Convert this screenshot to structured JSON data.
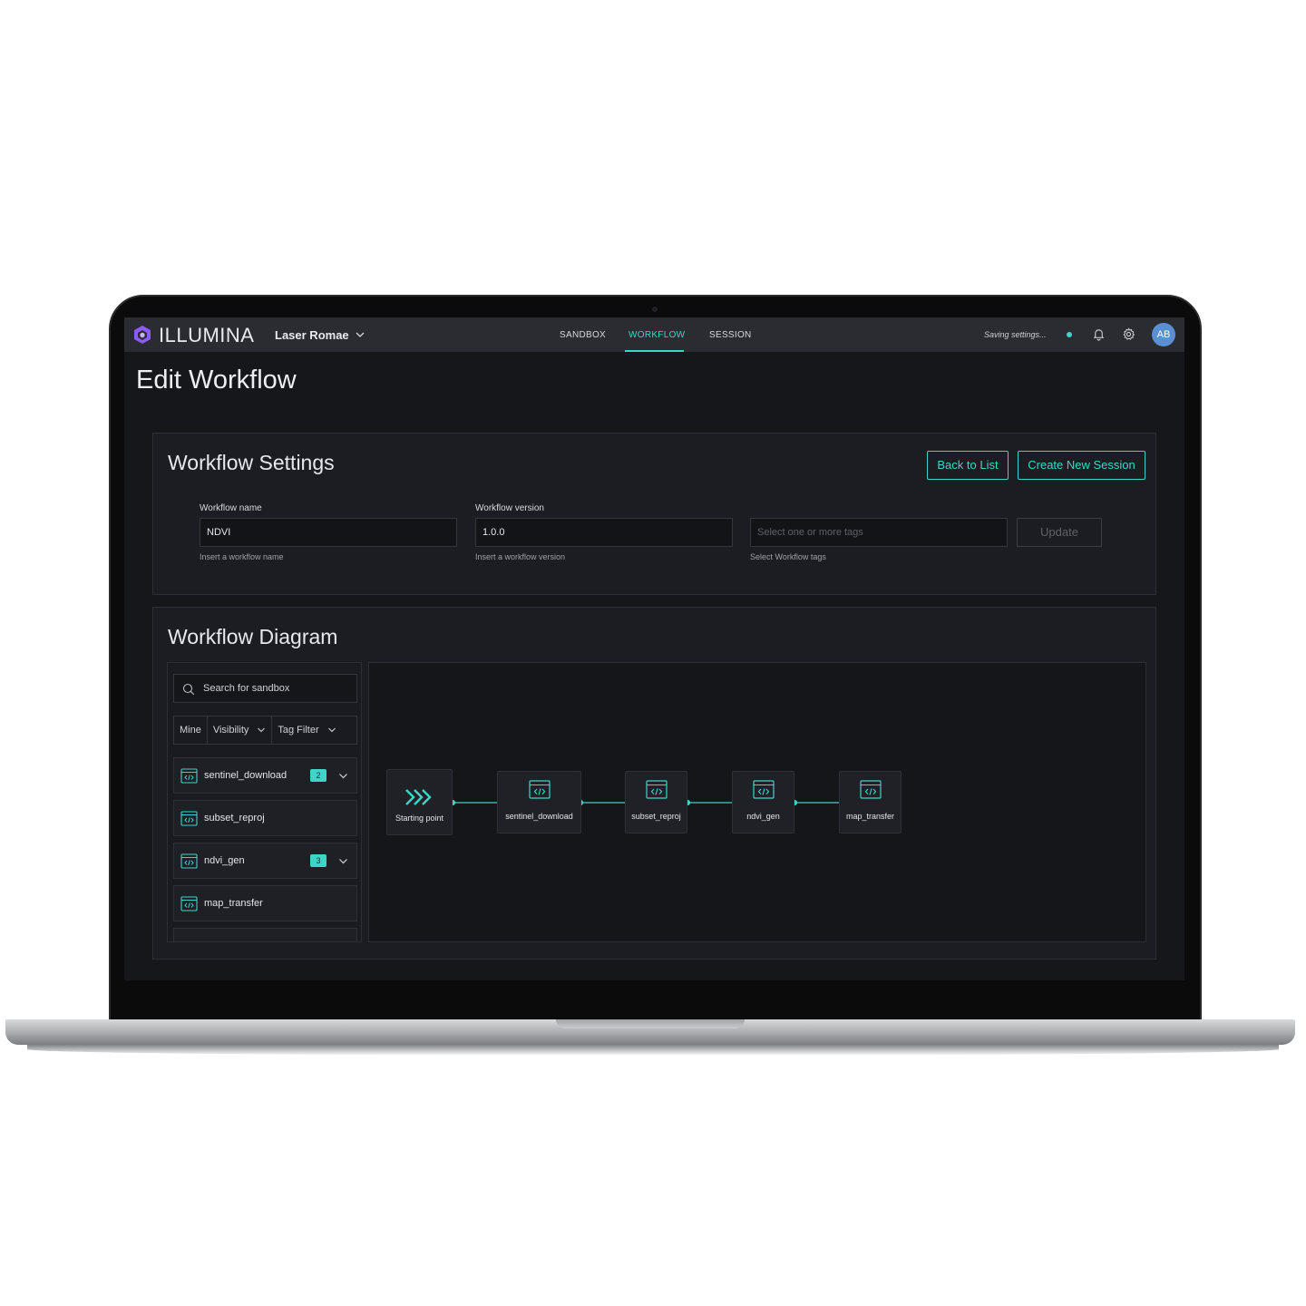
{
  "app": {
    "brand": "ILLUMINA",
    "project": "Laser Romae",
    "nav": [
      {
        "label": "SANDBOX",
        "active": false
      },
      {
        "label": "WORKFLOW",
        "active": true
      },
      {
        "label": "SESSION",
        "active": false
      }
    ],
    "status_text": "Saving settings...",
    "avatar_initials": "AB",
    "accent_color": "#3fd4c8",
    "icons": [
      "logo-icon",
      "chevron-down-icon",
      "bell-icon",
      "gear-icon",
      "search-icon",
      "code-window-icon",
      "chevrons-right-icon"
    ]
  },
  "page": {
    "title": "Edit Workflow"
  },
  "settings": {
    "title": "Workflow Settings",
    "back_label": "Back to List",
    "create_session_label": "Create New Session",
    "name": {
      "label": "Workflow name",
      "value": "NDVI",
      "help": "Insert a workflow name"
    },
    "version": {
      "label": "Workflow version",
      "value": "1.0.0",
      "help": "Insert a workflow version"
    },
    "tags": {
      "placeholder": "Select one or more tags",
      "help": "Select Workflow tags"
    },
    "update_label": "Update"
  },
  "diagram": {
    "title": "Workflow Diagram",
    "search_placeholder": "Search for sandbox",
    "filters": [
      "Mine",
      "Visibility",
      "Tag Filter"
    ],
    "sandbox_items": [
      {
        "label": "sentinel_download",
        "badge": "2"
      },
      {
        "label": "subset_reproj",
        "badge": ""
      },
      {
        "label": "ndvi_gen",
        "badge": "3"
      },
      {
        "label": "map_transfer",
        "badge": ""
      }
    ],
    "nodes": [
      "Starting point",
      "sentinel_download",
      "subset_reproj",
      "ndvi_gen",
      "map_transfer"
    ]
  }
}
